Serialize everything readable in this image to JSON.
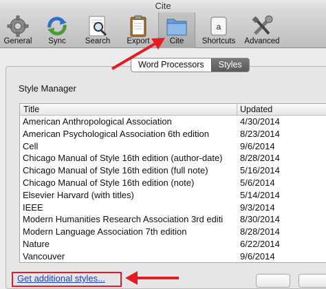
{
  "window": {
    "title": "Cite"
  },
  "toolbar": {
    "items": [
      {
        "label": "General",
        "icon": "gear-icon"
      },
      {
        "label": "Sync",
        "icon": "sync-icon"
      },
      {
        "label": "Search",
        "icon": "search-icon"
      },
      {
        "label": "Export",
        "icon": "clipboard-icon"
      },
      {
        "label": "Cite",
        "icon": "folder-icon",
        "selected": true
      },
      {
        "label": "Shortcuts",
        "icon": "keyboard-key-icon",
        "key_glyph": "a"
      },
      {
        "label": "Advanced",
        "icon": "tools-icon"
      }
    ]
  },
  "tabs": {
    "items": [
      {
        "label": "Word Processors"
      },
      {
        "label": "Styles",
        "selected": true
      }
    ]
  },
  "style_manager": {
    "label": "Style Manager",
    "columns": {
      "title": "Title",
      "updated": "Updated"
    },
    "rows": [
      {
        "title": "American Anthropological Association",
        "updated": "4/30/2014"
      },
      {
        "title": "American Psychological Association 6th edition",
        "updated": "8/23/2014"
      },
      {
        "title": "Cell",
        "updated": "9/6/2014"
      },
      {
        "title": "Chicago Manual of Style 16th edition (author-date)",
        "updated": "8/28/2014"
      },
      {
        "title": "Chicago Manual of Style 16th edition (full note)",
        "updated": "5/16/2014"
      },
      {
        "title": "Chicago Manual of Style 16th edition (note)",
        "updated": "5/6/2014"
      },
      {
        "title": "Elsevier Harvard (with titles)",
        "updated": "5/14/2014"
      },
      {
        "title": "IEEE",
        "updated": "9/3/2014"
      },
      {
        "title": "Modern Humanities Research Association 3rd editi",
        "updated": "8/30/2014"
      },
      {
        "title": "Modern Language Association 7th edition",
        "updated": "8/28/2014"
      },
      {
        "title": "Nature",
        "updated": "6/22/2014"
      },
      {
        "title": "Vancouver",
        "updated": "9/6/2014"
      }
    ]
  },
  "footer": {
    "link_label": "Get additional styles..."
  },
  "colors": {
    "annotation_red": "#e51b24",
    "link_blue": "#1a3fc4"
  }
}
